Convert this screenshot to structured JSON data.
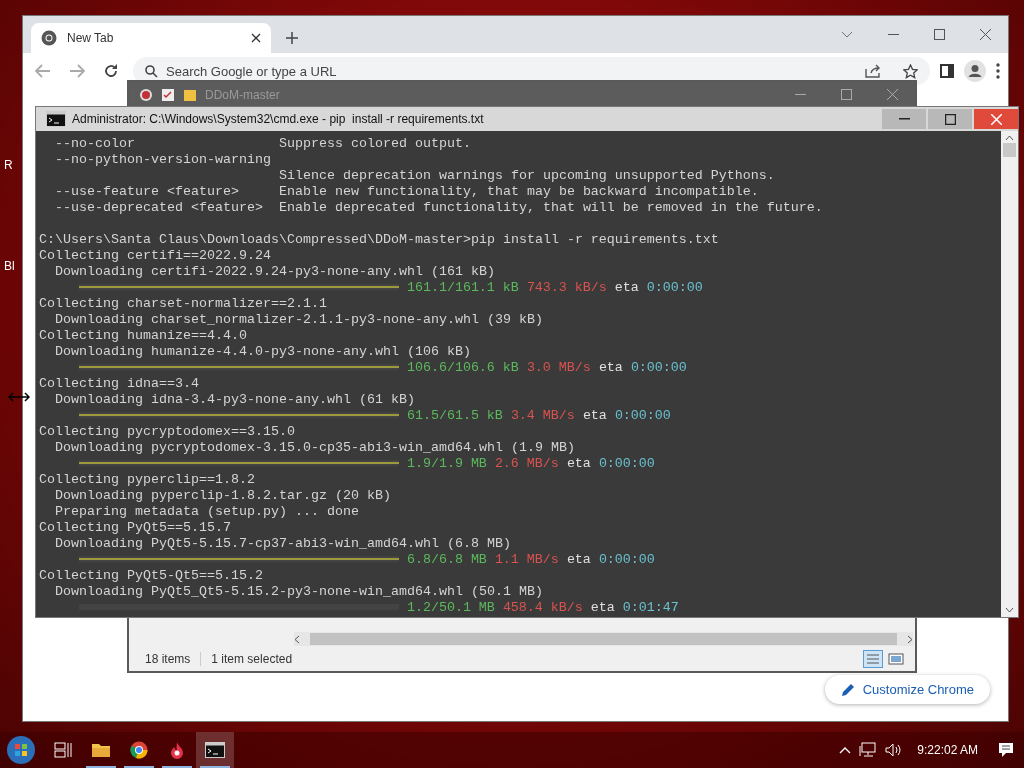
{
  "desktop": {
    "edge_labels": [
      "R",
      "Bl"
    ]
  },
  "chrome": {
    "tabs": [
      {
        "title": "New Tab",
        "selected": true
      }
    ],
    "omnibox": {
      "placeholder": "Search Google or type a URL"
    },
    "customize_button": "Customize Chrome"
  },
  "explorer": {
    "title": "DDoM-master",
    "status": {
      "item_count": "18 items",
      "selection": "1 item selected"
    }
  },
  "cmd": {
    "title": "Administrator: C:\\Windows\\System32\\cmd.exe - pip  install -r requirements.txt",
    "lines": [
      {
        "kind": "text",
        "text": "  --no-color                  Suppress colored output."
      },
      {
        "kind": "text",
        "text": "  --no-python-version-warning"
      },
      {
        "kind": "text",
        "text": "                              Silence deprecation warnings for upcoming unsupported Pythons."
      },
      {
        "kind": "text",
        "text": "  --use-feature <feature>     Enable new functionality, that may be backward incompatible."
      },
      {
        "kind": "text",
        "text": "  --use-deprecated <feature>  Enable deprecated functionality, that will be removed in the future."
      },
      {
        "kind": "blank"
      },
      {
        "kind": "text",
        "text": "C:\\Users\\Santa Claus\\Downloads\\Compressed\\DDoM-master>pip install -r requirements.txt"
      },
      {
        "kind": "text",
        "text": "Collecting certifi==2022.9.24"
      },
      {
        "kind": "text",
        "text": "  Downloading certifi-2022.9.24-py3-none-any.whl (161 kB)"
      },
      {
        "kind": "progress",
        "level": 1,
        "amount": "161.1/161.1 kB",
        "speed": "743.3 kB/s",
        "eta_label": "eta",
        "eta": "0:00:00"
      },
      {
        "kind": "text",
        "text": "Collecting charset-normalizer==2.1.1"
      },
      {
        "kind": "text",
        "text": "  Downloading charset_normalizer-2.1.1-py3-none-any.whl (39 kB)"
      },
      {
        "kind": "text",
        "text": "Collecting humanize==4.4.0"
      },
      {
        "kind": "text",
        "text": "  Downloading humanize-4.4.0-py3-none-any.whl (106 kB)"
      },
      {
        "kind": "progress",
        "level": 1,
        "amount": "106.6/106.6 kB",
        "speed": "3.0 MB/s",
        "eta_label": "eta",
        "eta": "0:00:00"
      },
      {
        "kind": "text",
        "text": "Collecting idna==3.4"
      },
      {
        "kind": "text",
        "text": "  Downloading idna-3.4-py3-none-any.whl (61 kB)"
      },
      {
        "kind": "progress",
        "level": 1,
        "amount": "61.5/61.5 kB",
        "speed": "3.4 MB/s",
        "eta_label": "eta",
        "eta": "0:00:00"
      },
      {
        "kind": "text",
        "text": "Collecting pycryptodomex==3.15.0"
      },
      {
        "kind": "text",
        "text": "  Downloading pycryptodomex-3.15.0-cp35-abi3-win_amd64.whl (1.9 MB)"
      },
      {
        "kind": "progress",
        "level": 1,
        "amount": "1.9/1.9 MB",
        "speed": "2.6 MB/s",
        "eta_label": "eta",
        "eta": "0:00:00"
      },
      {
        "kind": "text",
        "text": "Collecting pyperclip==1.8.2"
      },
      {
        "kind": "text",
        "text": "  Downloading pyperclip-1.8.2.tar.gz (20 kB)"
      },
      {
        "kind": "text",
        "text": "  Preparing metadata (setup.py) ... done"
      },
      {
        "kind": "text",
        "text": "Collecting PyQt5==5.15.7"
      },
      {
        "kind": "text",
        "text": "  Downloading PyQt5-5.15.7-cp37-abi3-win_amd64.whl (6.8 MB)"
      },
      {
        "kind": "progress",
        "level": 1,
        "amount": "6.8/6.8 MB",
        "speed": "1.1 MB/s",
        "eta_label": "eta",
        "eta": "0:00:00"
      },
      {
        "kind": "text",
        "text": "Collecting PyQt5-Qt5==5.15.2"
      },
      {
        "kind": "text",
        "text": "  Downloading PyQt5_Qt5-5.15.2-py3-none-win_amd64.whl (50.1 MB)"
      },
      {
        "kind": "progress",
        "amount": "1.2/50.1 MB",
        "speed": "458.4 kB/s",
        "eta_label": "eta",
        "eta": "0:01:47"
      }
    ]
  },
  "taskbar": {
    "apps": [
      {
        "kind": "explorer",
        "active": false
      },
      {
        "kind": "chrome",
        "active": false
      },
      {
        "kind": "flame",
        "active": false
      },
      {
        "kind": "console",
        "active": true
      }
    ],
    "clock": "9:22:02 AM"
  }
}
